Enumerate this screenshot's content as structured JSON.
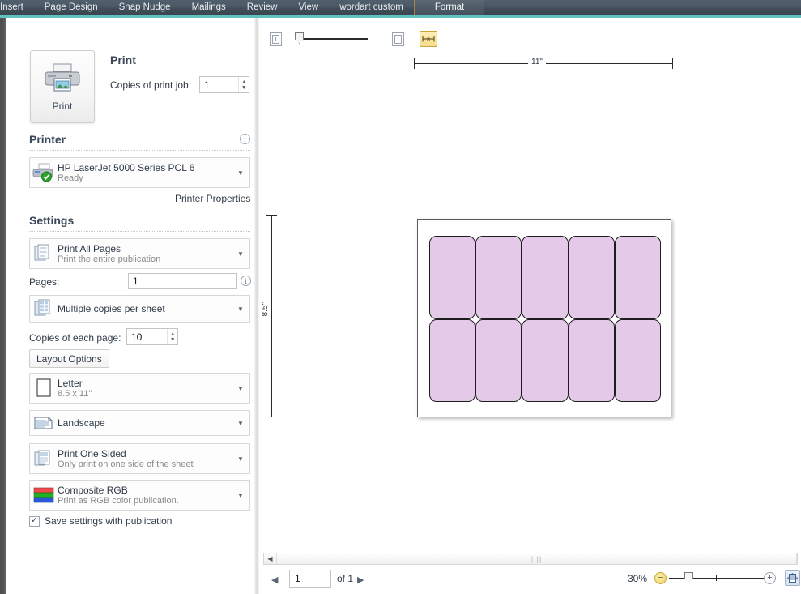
{
  "ribbon": {
    "tabs": [
      {
        "label": "Insert",
        "contextual": false
      },
      {
        "label": "Page Design",
        "contextual": false
      },
      {
        "label": "Snap Nudge",
        "contextual": false
      },
      {
        "label": "Mailings",
        "contextual": false
      },
      {
        "label": "Review",
        "contextual": false
      },
      {
        "label": "View",
        "contextual": false
      },
      {
        "label": "wordart custom",
        "contextual": false
      },
      {
        "label": "Format",
        "contextual": true
      }
    ],
    "accent_underline_color": "#5fc2c0",
    "contextual_border_color": "#a8843c"
  },
  "panel": {
    "print_button": {
      "label": "Print",
      "icon": "printer-icon"
    },
    "print_heading": "Print",
    "copies_label": "Copies of print job:",
    "copies_value": "1",
    "printer_heading": "Printer",
    "printer_info_icon": "info-icon",
    "printer": {
      "name": "HP LaserJet 5000 Series PCL 6",
      "status": "Ready",
      "icon": "printer-status-icon"
    },
    "printer_properties_link": "Printer Properties",
    "settings_heading": "Settings",
    "print_range": {
      "title": "Print All Pages",
      "subtitle": "Print the entire publication",
      "icon": "pages-icon"
    },
    "pages_label": "Pages:",
    "pages_value": "1",
    "pages_info_icon": "info-icon",
    "sheet_layout": {
      "title": "Multiple copies per sheet",
      "subtitle": "",
      "icon": "multi-copies-icon"
    },
    "copies_each_label": "Copies of each page:",
    "copies_each_value": "10",
    "layout_options_button": "Layout Options",
    "paper_size": {
      "title": "Letter",
      "subtitle": "8.5 x 11\"",
      "icon": "paper-icon"
    },
    "orientation": {
      "title": "Landscape",
      "subtitle": "",
      "icon": "landscape-icon"
    },
    "sides": {
      "title": "Print One Sided",
      "subtitle": "Only print on one side of the sheet",
      "icon": "one-sided-icon"
    },
    "color_mode": {
      "title": "Composite RGB",
      "subtitle": "Print as RGB color publication.",
      "icon": "rgb-color-icon"
    },
    "save_settings": {
      "label": "Save settings with publication",
      "checked": true
    }
  },
  "preview": {
    "toolbar": {
      "front_page_icon": "page-front-icon",
      "back_page_icon": "page-back-icon",
      "ruler_icon": "ruler-measure-icon",
      "slider_position_pct": 5
    },
    "ruler_horizontal_label": "11\"",
    "ruler_vertical_label": "8.5\"",
    "sheet": {
      "label_fill_color": "#e4c9e8",
      "label_border_color": "#1d1d1d",
      "columns": 5,
      "rows": 2,
      "total_labels": 10
    },
    "hscroll": {
      "left_arrow_icon": "chevron-left-icon",
      "thumb_grip": "||||"
    }
  },
  "status": {
    "prev_page_icon": "prev-page-icon",
    "next_page_icon": "next-page-icon",
    "page_value": "1",
    "page_of": "of 1",
    "zoom_label": "30%",
    "zoom_out_icon": "zoom-out-icon",
    "zoom_in_icon": "zoom-in-icon",
    "zoom_slider_pct": 18,
    "view_single_page_icon": "single-page-view-icon",
    "view_multi_page_icon": "multi-page-view-icon"
  }
}
